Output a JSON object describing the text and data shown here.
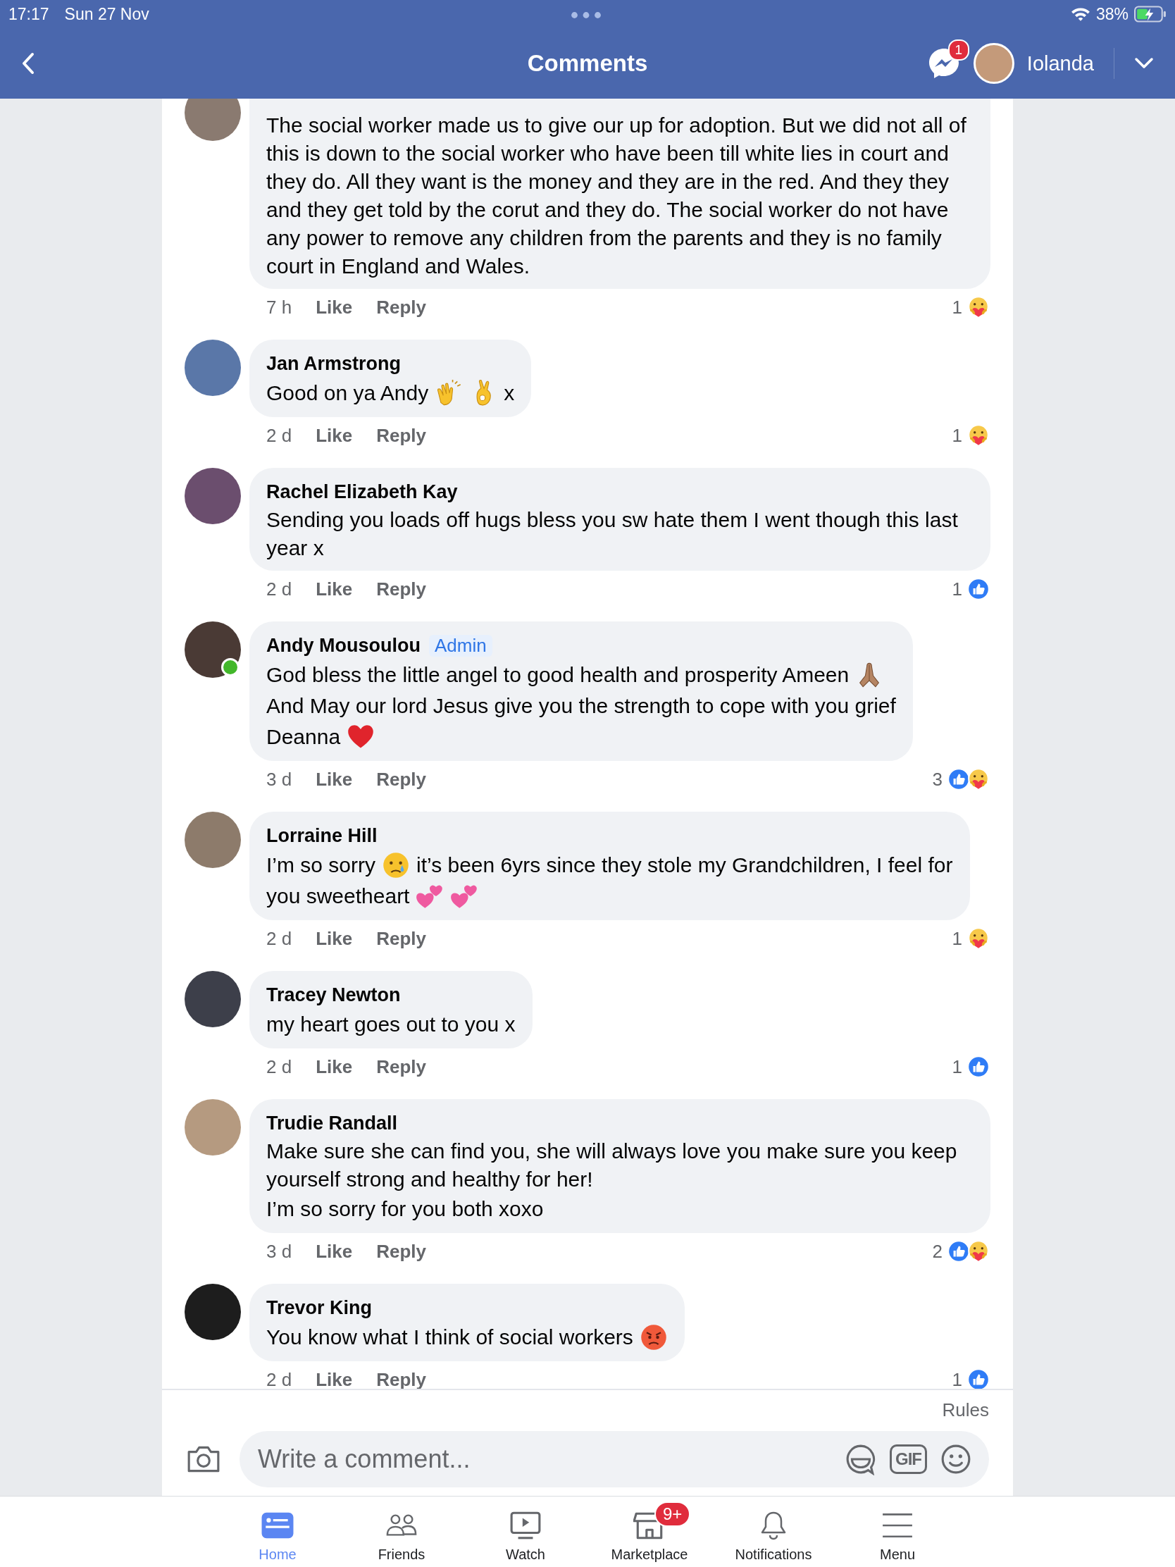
{
  "status_bar": {
    "time": "17:17",
    "date": "Sun 27 Nov",
    "battery": "38%"
  },
  "header": {
    "title": "Comments",
    "messenger_badge": "1",
    "user": "Iolanda"
  },
  "comments": [
    {
      "lines": [
        [
          {
            "kind": "text",
            "text": "The social worker made us to give our up for adoption. But we did not all of this is down to the social worker who have been till white lies in court and they do. All they want is the money and they are in the red. And they they and they get told by the corut and they do. The social worker do not have any power to remove any children from the parents and they is no family court in England and Wales."
          }
        ]
      ],
      "time": "7 h",
      "like": "Like",
      "reply": "Reply",
      "reaction_count": "1",
      "reactions": [
        {
          "kind": "care"
        }
      ]
    },
    {
      "author": "Jan Armstrong",
      "online": false,
      "lines": [
        [
          {
            "kind": "text",
            "text": "Good on ya Andy"
          },
          {
            "kind": "clap-emoji"
          },
          {
            "kind": "ok-emoji"
          },
          {
            "kind": "text",
            "text": "x"
          }
        ]
      ],
      "time": "2 d",
      "like": "Like",
      "reply": "Reply",
      "reaction_count": "1",
      "reactions": [
        {
          "kind": "care"
        }
      ]
    },
    {
      "author": "Rachel Elizabeth Kay",
      "online": false,
      "lines": [
        [
          {
            "kind": "text",
            "text": "Sending you loads off hugs bless you sw hate them I went though this last year x"
          }
        ]
      ],
      "time": "2 d",
      "like": "Like",
      "reply": "Reply",
      "reaction_count": "1",
      "reactions": [
        {
          "kind": "like"
        }
      ]
    },
    {
      "author": "Andy Mousoulou",
      "badge": "Admin",
      "online": true,
      "lines": [
        [
          {
            "kind": "text",
            "text": "God bless the little angel to good health and prosperity Ameen"
          },
          {
            "kind": "pray-emoji"
          }
        ],
        [
          {
            "kind": "text",
            "text": "And May our lord Jesus give you the strength to cope with you grief"
          }
        ],
        [
          {
            "kind": "text",
            "text": "Deanna"
          },
          {
            "kind": "heart-emoji"
          }
        ]
      ],
      "time": "3 d",
      "like": "Like",
      "reply": "Reply",
      "reaction_count": "3",
      "reactions": [
        {
          "kind": "like"
        },
        {
          "kind": "care"
        }
      ]
    },
    {
      "author": "Lorraine Hill",
      "online": false,
      "lines": [
        [
          {
            "kind": "text",
            "text": "I’m so sorry"
          },
          {
            "kind": "cry-emoji"
          },
          {
            "kind": "text",
            "text": "it’s been 6yrs since they stole my Grandchildren, I feel for"
          }
        ],
        [
          {
            "kind": "text",
            "text": "you sweetheart"
          },
          {
            "kind": "hearts-emoji"
          },
          {
            "kind": "hearts-emoji"
          }
        ]
      ],
      "time": "2 d",
      "like": "Like",
      "reply": "Reply",
      "reaction_count": "1",
      "reactions": [
        {
          "kind": "care"
        }
      ]
    },
    {
      "author": "Tracey Newton",
      "online": false,
      "lines": [
        [
          {
            "kind": "text",
            "text": "my heart goes out to you x"
          }
        ]
      ],
      "time": "2 d",
      "like": "Like",
      "reply": "Reply",
      "reaction_count": "1",
      "reactions": [
        {
          "kind": "like"
        }
      ]
    },
    {
      "author": "Trudie Randall",
      "online": false,
      "lines": [
        [
          {
            "kind": "text",
            "text": "Make sure she can find you, she will always love you make sure you keep yourself strong and healthy for her!"
          }
        ],
        [
          {
            "kind": "text",
            "text": "I’m so sorry for you both xoxo"
          }
        ]
      ],
      "time": "3 d",
      "like": "Like",
      "reply": "Reply",
      "reaction_count": "2",
      "reactions": [
        {
          "kind": "like"
        },
        {
          "kind": "care"
        }
      ]
    },
    {
      "author": "Trevor King",
      "online": false,
      "lines": [
        [
          {
            "kind": "text",
            "text": "You know what I think of social workers"
          },
          {
            "kind": "angry-emoji"
          }
        ]
      ],
      "time": "2 d",
      "like": "Like",
      "reply": "Reply",
      "reaction_count": "1",
      "reactions": [
        {
          "kind": "like"
        }
      ]
    }
  ],
  "composer": {
    "rules": "Rules",
    "placeholder": "Write a comment...",
    "gif": "GIF"
  },
  "tab_bar": [
    {
      "label": "Home",
      "selected": true
    },
    {
      "label": "Friends",
      "selected": false
    },
    {
      "label": "Watch",
      "selected": false
    },
    {
      "label": "Marketplace",
      "selected": false,
      "badge": "9+"
    },
    {
      "label": "Notifications",
      "selected": false
    },
    {
      "label": "Menu",
      "selected": false
    }
  ]
}
